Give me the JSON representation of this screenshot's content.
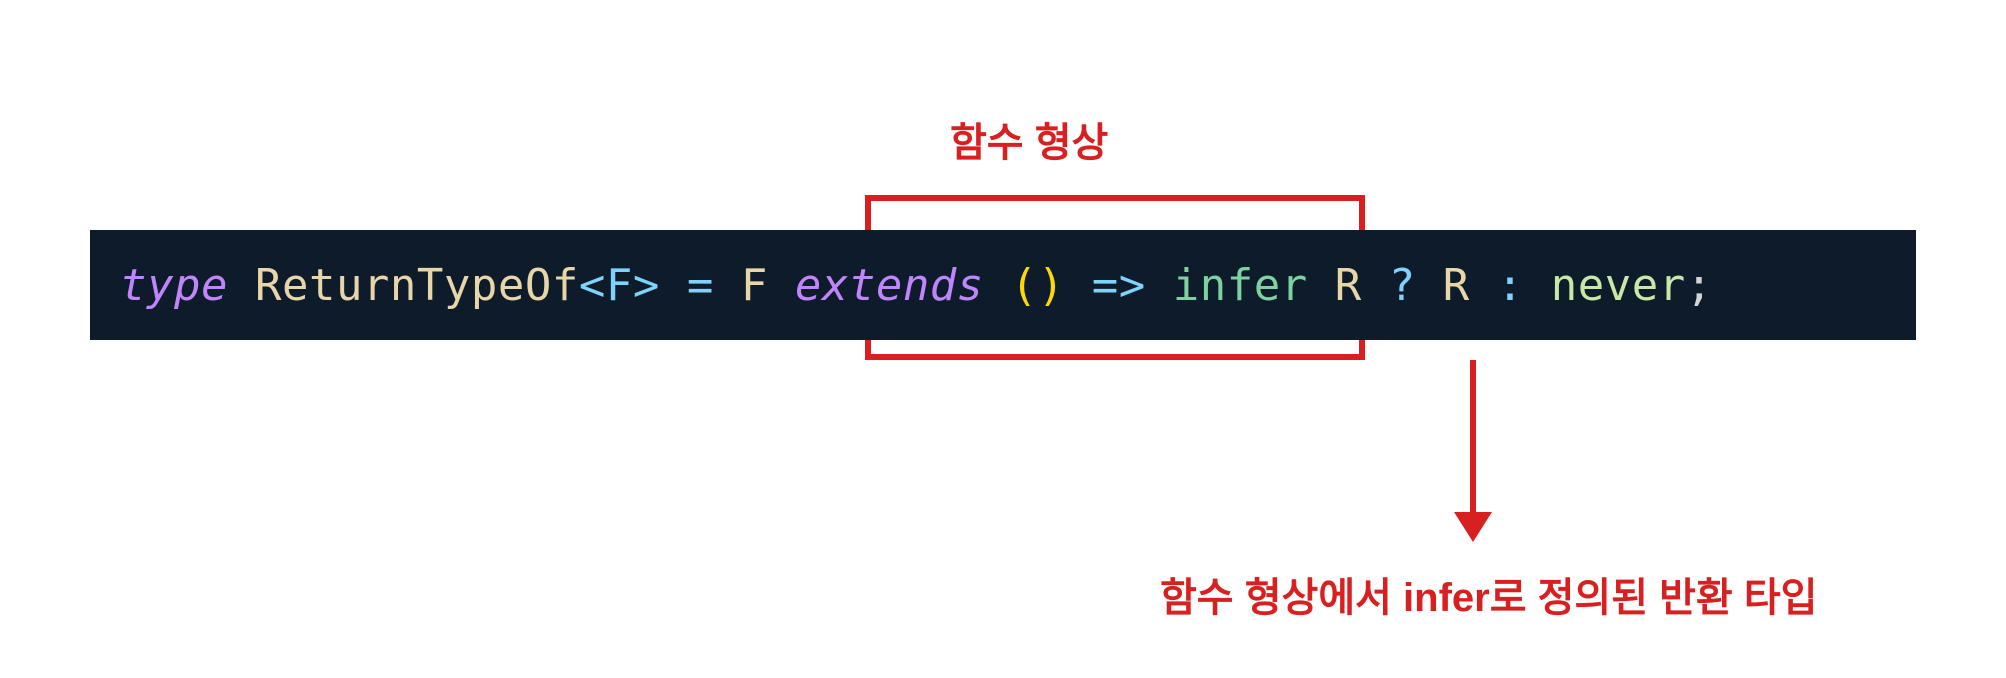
{
  "annotations": {
    "top": "함수 형상",
    "bottom": "함수 형상에서 infer로 정의된 반환 타입"
  },
  "code": {
    "keyword_type": "type",
    "type_name": "ReturnTypeOf",
    "angle_open": "<",
    "generic_param": "F",
    "angle_close": ">",
    "equals": "=",
    "var_f": "F",
    "extends_kw": "extends",
    "paren_open": "(",
    "paren_close": ")",
    "arrow": "=>",
    "infer_kw": "infer",
    "var_r": "R",
    "question": "?",
    "var_r2": "R",
    "colon": ":",
    "never_kw": "never",
    "semicolon": ";"
  }
}
